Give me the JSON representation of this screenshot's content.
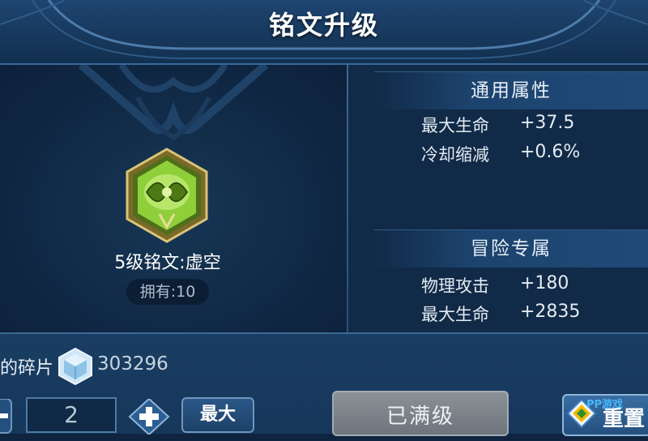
{
  "header": {
    "title": "铭文升级"
  },
  "rune": {
    "name": "5级铭文:虚空",
    "owned": "拥有:10",
    "icon": "hexagon-rune-icon",
    "color": "#8fcf3a"
  },
  "general": {
    "title": "通用属性",
    "stats": [
      {
        "label": "最大生命",
        "value": "+37.5"
      },
      {
        "label": "冷却缩减",
        "value": "+0.6%"
      }
    ]
  },
  "adventure": {
    "title": "冒险专属",
    "stats": [
      {
        "label": "物理攻击",
        "value": "+180"
      },
      {
        "label": "最大生命",
        "value": "+2835"
      }
    ]
  },
  "fragments": {
    "label": "的碎片",
    "count": "303296",
    "icon": "crystal-icon"
  },
  "controls": {
    "quantity": "2",
    "max_label": "最大",
    "upgrade_label": "已满级",
    "reset_label": "重置"
  },
  "watermark": {
    "text": "PP游戏"
  },
  "colors": {
    "background": "#0e2440",
    "panel": "#112a47",
    "accent": "#3b6994",
    "disabled_button": "#7c838a"
  }
}
